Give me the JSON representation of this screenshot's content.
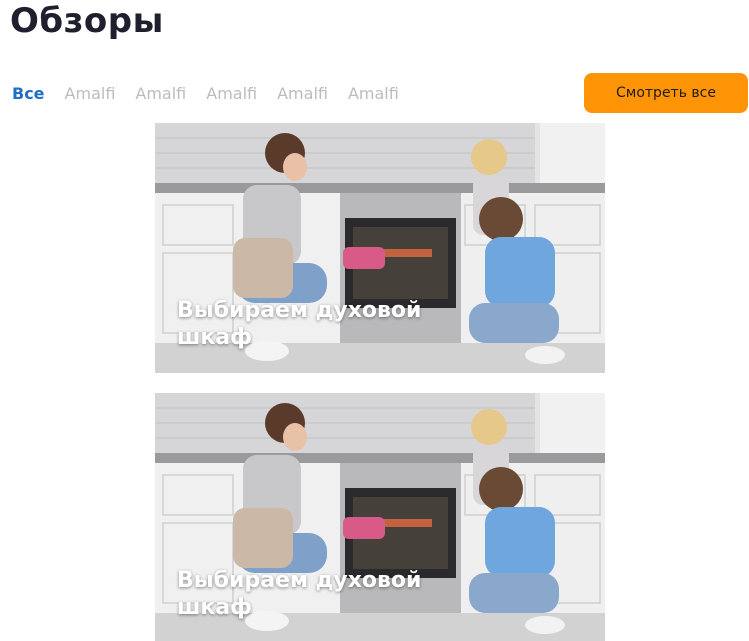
{
  "page": {
    "title": "Обзоры"
  },
  "tabs": [
    {
      "label": "Все",
      "active": true
    },
    {
      "label": "Amalfi",
      "active": false
    },
    {
      "label": "Amalfi",
      "active": false
    },
    {
      "label": "Amalfi",
      "active": false
    },
    {
      "label": "Amalfi",
      "active": false
    },
    {
      "label": "Amalfi",
      "active": false
    }
  ],
  "view_all_button": {
    "label": "Смотреть все"
  },
  "cards": [
    {
      "title": "Выбираем духовой шкаф"
    },
    {
      "title": "Выбираем духовой шкаф"
    }
  ],
  "colors": {
    "accent_button": "#ff9506",
    "active_tab": "#1f6fc4",
    "inactive_tab": "#b9bcc2",
    "title": "#1f1f2e"
  }
}
